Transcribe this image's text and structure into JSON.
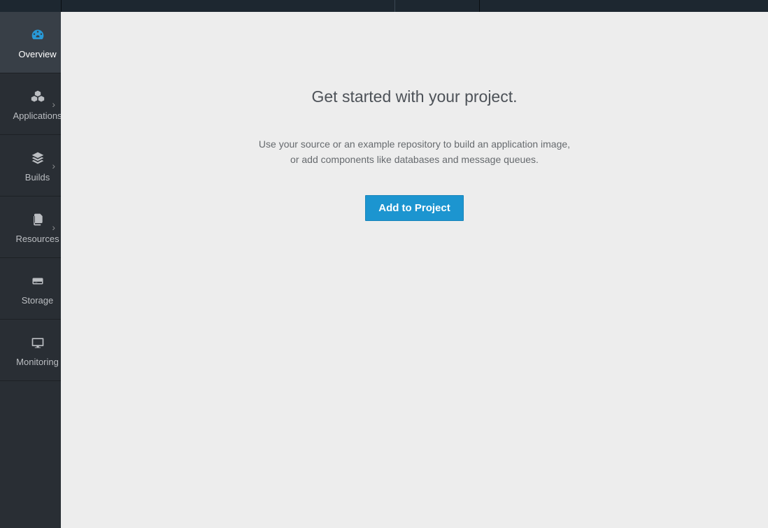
{
  "sidebar": {
    "items": [
      {
        "label": "Overview"
      },
      {
        "label": "Applications"
      },
      {
        "label": "Builds"
      },
      {
        "label": "Resources"
      },
      {
        "label": "Storage"
      },
      {
        "label": "Monitoring"
      }
    ]
  },
  "main": {
    "heading": "Get started with your project.",
    "subtext": "Use your source or an example repository to build an application image, or add components like databases and message queues.",
    "cta_label": "Add to Project"
  }
}
